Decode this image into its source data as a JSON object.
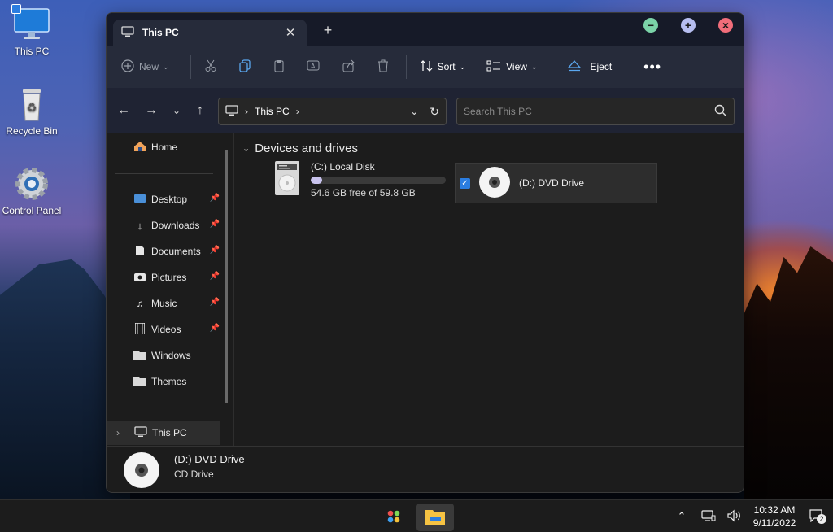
{
  "desktop": {
    "icons": [
      {
        "label": "This PC",
        "icon": "monitor-icon",
        "selected": true
      },
      {
        "label": "Recycle Bin",
        "icon": "recycle-bin-icon"
      },
      {
        "label": "Control Panel",
        "icon": "gear-icon"
      }
    ]
  },
  "window": {
    "tab_title": "This PC",
    "tab_icon": "monitor-icon",
    "controls": {
      "minimize_color": "#7bd3a8",
      "maximize_color": "#b7bef0",
      "close_color": "#f16d7a"
    }
  },
  "toolbar": {
    "new_label": "New",
    "sort_label": "Sort",
    "view_label": "View",
    "eject_label": "Eject",
    "icons": [
      "cut-icon",
      "copy-icon",
      "paste-icon",
      "rename-icon",
      "share-icon",
      "delete-icon",
      "more-icon"
    ]
  },
  "address": {
    "crumb": "This PC",
    "search_placeholder": "Search This PC"
  },
  "sidebar": {
    "home": "Home",
    "quick": [
      {
        "label": "Desktop",
        "icon": "desktop-folder-icon",
        "pinned": true
      },
      {
        "label": "Downloads",
        "icon": "download-icon",
        "pinned": true
      },
      {
        "label": "Documents",
        "icon": "documents-icon",
        "pinned": true
      },
      {
        "label": "Pictures",
        "icon": "camera-icon",
        "pinned": true
      },
      {
        "label": "Music",
        "icon": "music-icon",
        "pinned": true
      },
      {
        "label": "Videos",
        "icon": "video-icon",
        "pinned": true
      },
      {
        "label": "Windows",
        "icon": "folder-icon",
        "pinned": false
      },
      {
        "label": "Themes",
        "icon": "folder-icon",
        "pinned": false
      }
    ],
    "this_pc": "This PC"
  },
  "content": {
    "group_title": "Devices and drives",
    "drives": [
      {
        "name": "(C:) Local Disk",
        "free_text": "54.6 GB free of 59.8 GB",
        "used_fraction": 0.087
      },
      {
        "name": "(D:) DVD Drive",
        "selected": true
      }
    ]
  },
  "details": {
    "name": "(D:) DVD Drive",
    "type": "CD Drive"
  },
  "taskbar": {
    "time": "10:32 AM",
    "date": "9/11/2022",
    "notification_count": "2"
  }
}
